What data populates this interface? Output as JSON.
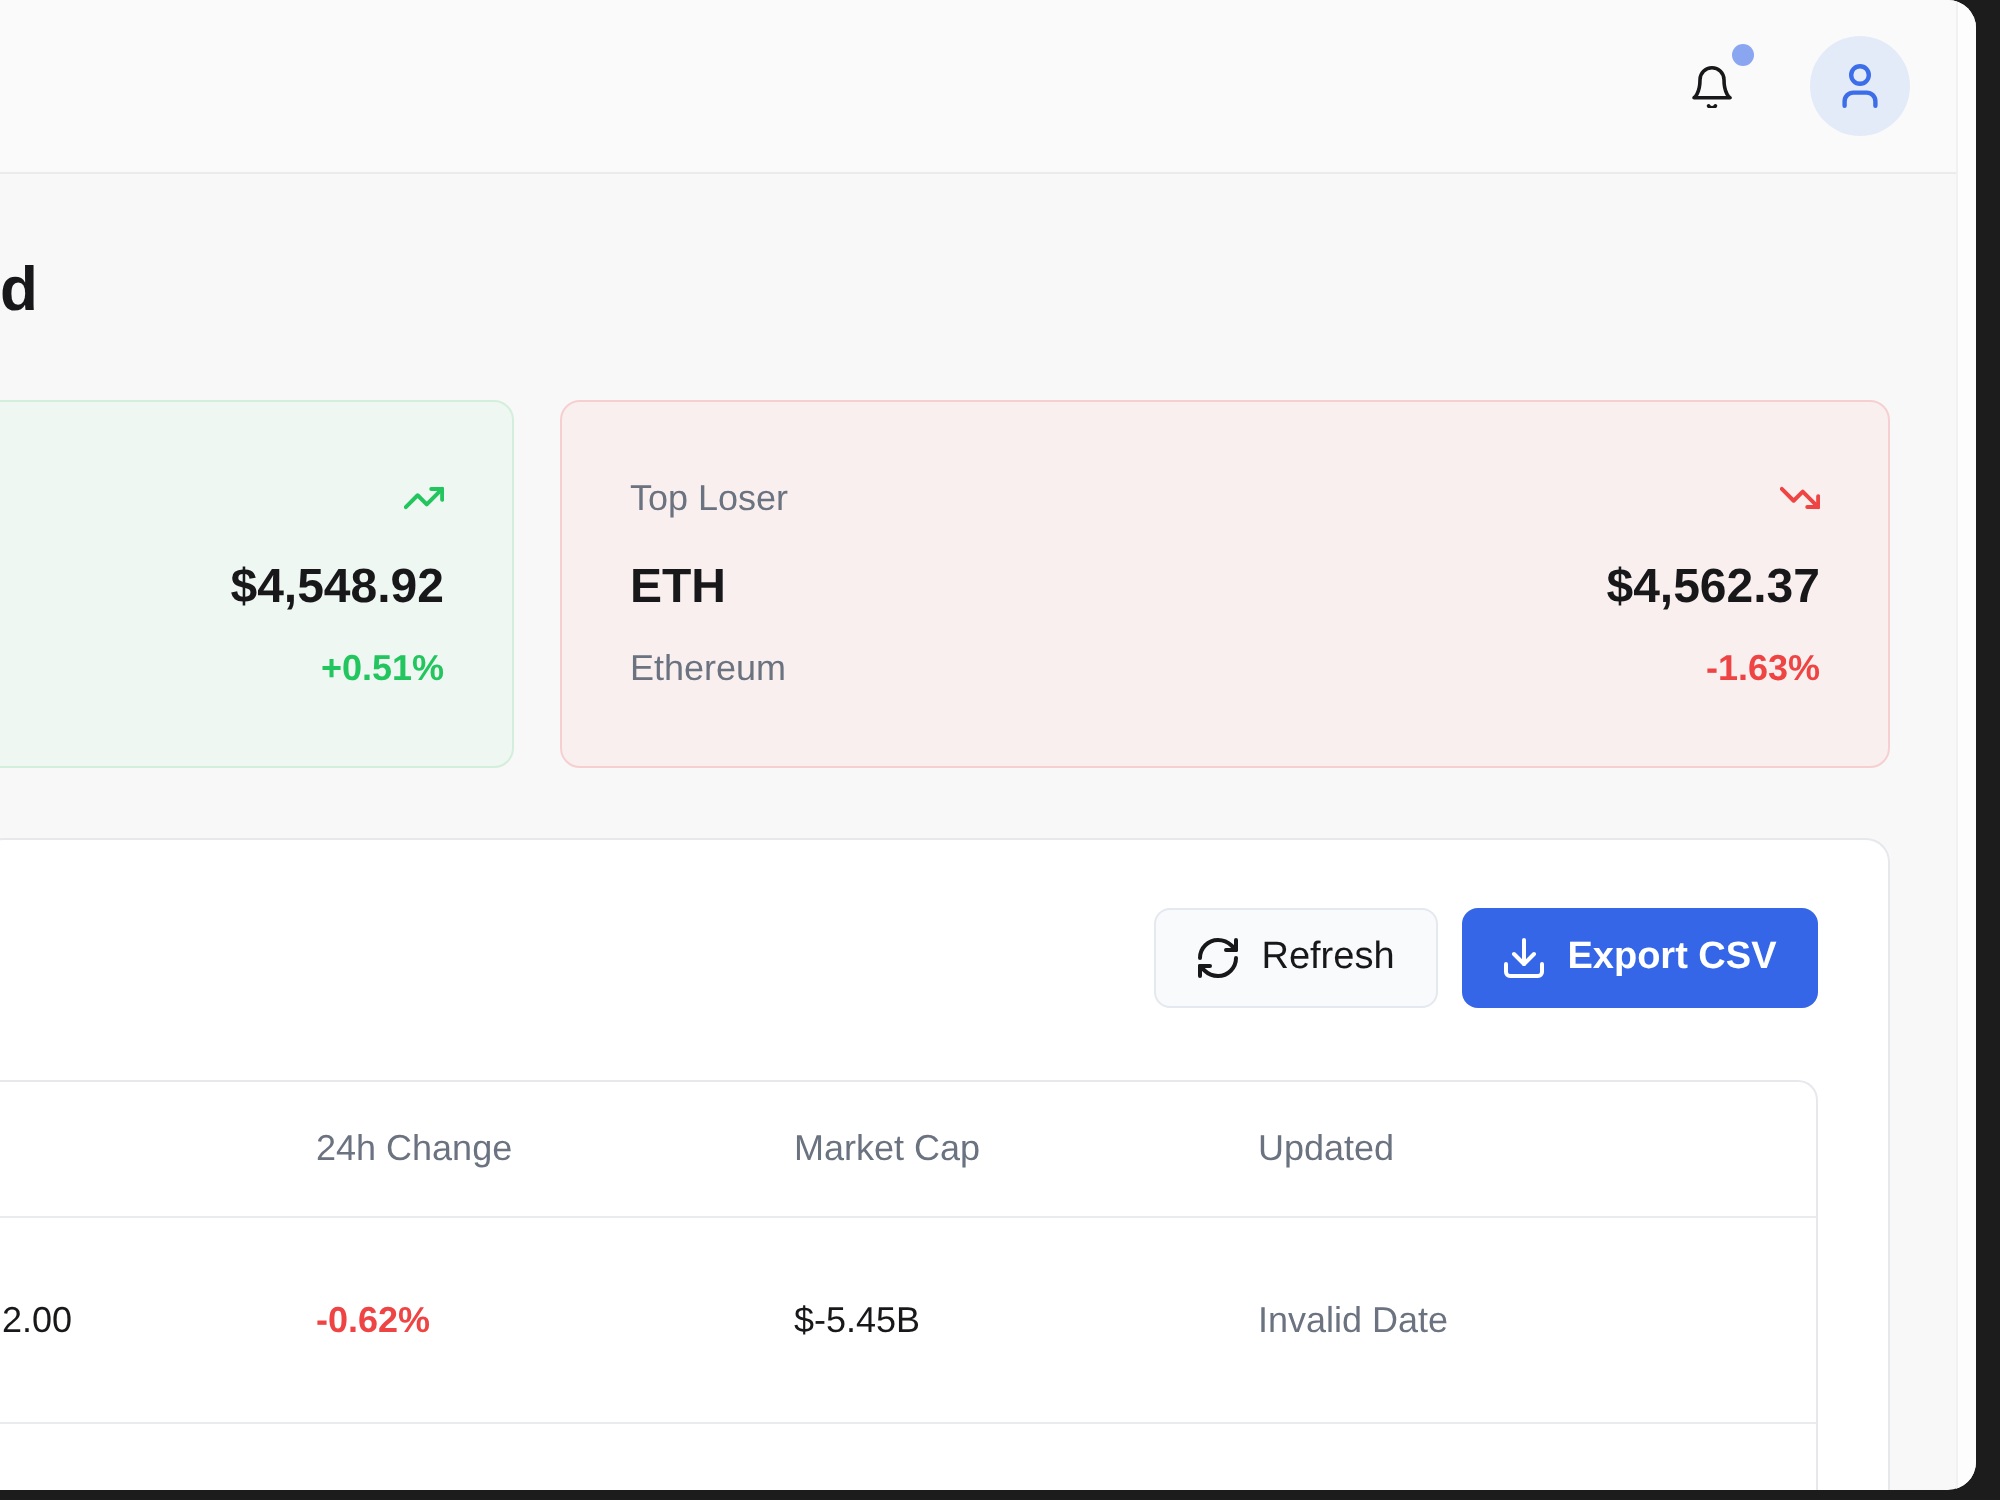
{
  "header": {
    "notifications": {
      "unread": true
    }
  },
  "page_title": "d",
  "summary_cards": [
    {
      "gain": true,
      "price": "$4,548.92",
      "change": "+0.51%"
    },
    {
      "gain": false,
      "label": "Top Loser",
      "symbol": "ETH",
      "name": "Ethereum",
      "price": "$4,562.37",
      "change": "-1.63%"
    }
  ],
  "actions": [
    {
      "kind": "refresh",
      "label": "Refresh"
    },
    {
      "kind": "export",
      "label": "Export CSV"
    }
  ],
  "table": {
    "columns": [
      "24h Change",
      "Market Cap",
      "Updated"
    ],
    "rows": [
      {
        "column_1": "2.00",
        "change": "-0.62%",
        "gain": false,
        "market_cap": "$-5.45B",
        "updated": "Invalid Date"
      }
    ]
  }
}
